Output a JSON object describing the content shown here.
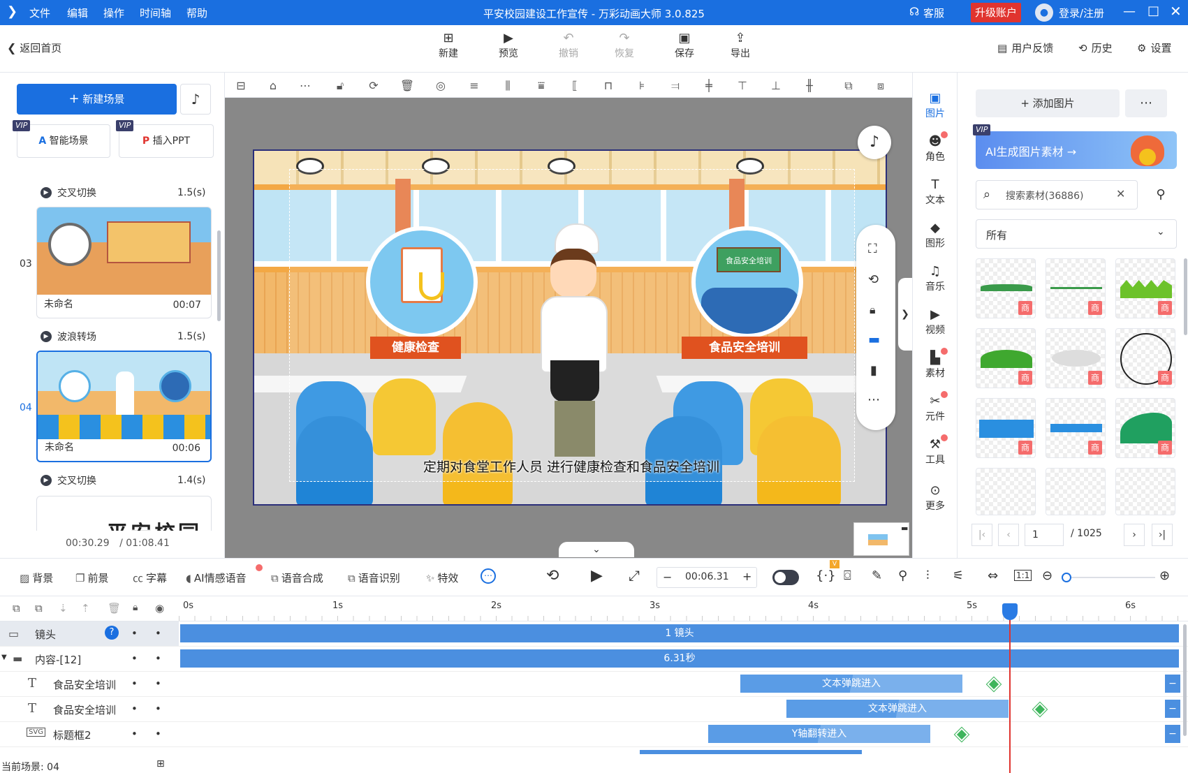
{
  "titlebar": {
    "menus": [
      "文件",
      "编辑",
      "操作",
      "时间轴",
      "帮助"
    ],
    "title": "平安校园建设工作宣传 - 万彩动画大师 3.0.825",
    "service": "客服",
    "upgrade": "升级账户",
    "login": "登录/注册"
  },
  "toolbar": {
    "back": "返回首页",
    "buttons": [
      "新建",
      "预览",
      "撤销",
      "恢复",
      "保存",
      "导出"
    ],
    "feedback": "用户反馈",
    "history": "历史",
    "settings": "设置"
  },
  "left": {
    "new_scene": "新建场景",
    "vip": "VIP",
    "smart_scene": "智能场景",
    "insert_ppt": "插入PPT",
    "transitions": [
      {
        "name": "交叉切换",
        "duration": "1.5(s)"
      },
      {
        "name": "波浪转场",
        "duration": "1.5(s)"
      },
      {
        "name": "交叉切换",
        "duration": "1.4(s)"
      }
    ],
    "scenes": [
      {
        "index": "03",
        "name": "未命名",
        "time": "00:07"
      },
      {
        "index": "04",
        "name": "未命名",
        "time": "00:06"
      }
    ],
    "next_scene_text": "平安校园",
    "current_time": "00:30.29",
    "total_time": "/ 01:08.41"
  },
  "stage": {
    "subtitle": "定期对食堂工作人员 进行健康检查和食品安全培训",
    "badge_left": "健康检查",
    "badge_right": "食品安全培训",
    "board_text": "食品安全培训"
  },
  "rightcol": {
    "items": [
      {
        "label": "图片",
        "icon": "image-icon",
        "active": true,
        "badge": false
      },
      {
        "label": "角色",
        "icon": "character-icon",
        "active": false,
        "badge": true
      },
      {
        "label": "文本",
        "icon": "text-icon",
        "active": false,
        "badge": false
      },
      {
        "label": "图形",
        "icon": "shape-icon",
        "active": false,
        "badge": false
      },
      {
        "label": "音乐",
        "icon": "music-icon",
        "active": false,
        "badge": false
      },
      {
        "label": "视频",
        "icon": "video-icon",
        "active": false,
        "badge": false
      },
      {
        "label": "素材",
        "icon": "material-icon",
        "active": false,
        "badge": true
      },
      {
        "label": "元件",
        "icon": "component-icon",
        "active": false,
        "badge": true
      },
      {
        "label": "工具",
        "icon": "tool-icon",
        "active": false,
        "badge": true
      },
      {
        "label": "更多",
        "icon": "more-icon",
        "active": false,
        "badge": false
      }
    ]
  },
  "assets": {
    "add_image": "添加图片",
    "ai_banner": "AI生成图片素材 →",
    "search_placeholder": "搜索素材(36886)",
    "filter_value": "所有",
    "badge": "商",
    "page_current": "1",
    "page_total": "/ 1025"
  },
  "bottombar": {
    "items": [
      "背景",
      "前景",
      "字幕",
      "AI情感语音",
      "语音合成",
      "语音识别",
      "特效"
    ],
    "time_value": "00:06.31"
  },
  "timeline": {
    "ticks": [
      "0s",
      "1s",
      "2s",
      "3s",
      "4s",
      "5s",
      "6s"
    ],
    "playhead_fraction": 0.829,
    "tracks": [
      {
        "name": "镜头",
        "bar": "1 镜头"
      },
      {
        "name": "内容-[12]",
        "bar": "6.31秒"
      },
      {
        "name": "食品安全培训",
        "bar": "文本弹跳进入"
      },
      {
        "name": "食品安全培训",
        "bar": "文本弹跳进入"
      },
      {
        "name": "标题框2",
        "bar": "Y轴翻转进入"
      }
    ],
    "current_scene": "当前场景: 04"
  },
  "colors": {
    "accent": "#1a6fe0",
    "bar": "#4b8fe0",
    "upgrade": "#e0342f",
    "vip": "#3a3f6b",
    "diamond": "#3eb55c",
    "playhead": "#e0342f"
  }
}
